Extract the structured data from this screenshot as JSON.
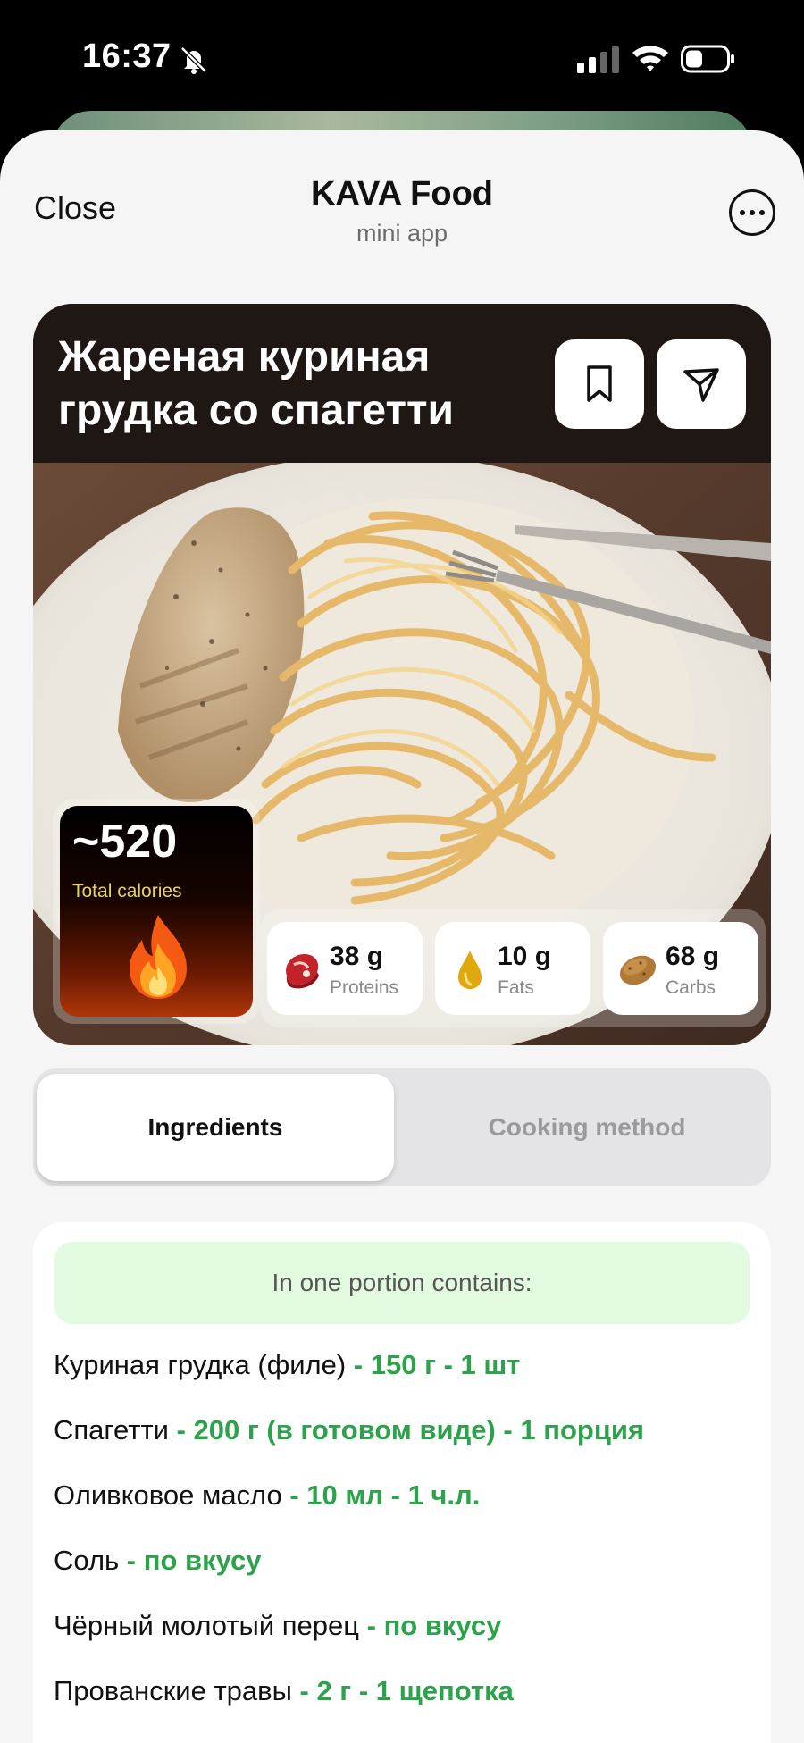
{
  "status_bar": {
    "time": "16:37"
  },
  "nav": {
    "close_label": "Close",
    "title": "KAVA Food",
    "subtitle": "mini app"
  },
  "recipe": {
    "title": "Жареная куриная грудка со спагетти",
    "calories": {
      "value": "~520",
      "label": "Total calories"
    },
    "macros": [
      {
        "icon": "steak-icon",
        "value": "38 g",
        "label": "Proteins"
      },
      {
        "icon": "oil-drop-icon",
        "value": "10 g",
        "label": "Fats"
      },
      {
        "icon": "potato-icon",
        "value": "68 g",
        "label": "Carbs"
      }
    ]
  },
  "tabs": [
    {
      "label": "Ingredients",
      "active": true
    },
    {
      "label": "Cooking method",
      "active": false
    }
  ],
  "ingredients": {
    "header": "In one portion contains:",
    "items": [
      {
        "name": "Куриная грудка (филе)",
        "amount": " - 150 г - 1 шт"
      },
      {
        "name": "Спагетти",
        "amount": " - 200 г (в готовом виде) - 1 порция"
      },
      {
        "name": "Оливковое масло",
        "amount": " - 10 мл - 1 ч.л."
      },
      {
        "name": "Соль",
        "amount": " - по вкусу"
      },
      {
        "name": "Чёрный молотый перец",
        "amount": " - по вкусу"
      },
      {
        "name": "Прованские травы",
        "amount": " - 2 г - 1 щепотка"
      }
    ]
  },
  "colors": {
    "accent_green": "#2ca24a",
    "banner_green": "#e2fae0",
    "sheet_bg": "#f5f5f6"
  }
}
